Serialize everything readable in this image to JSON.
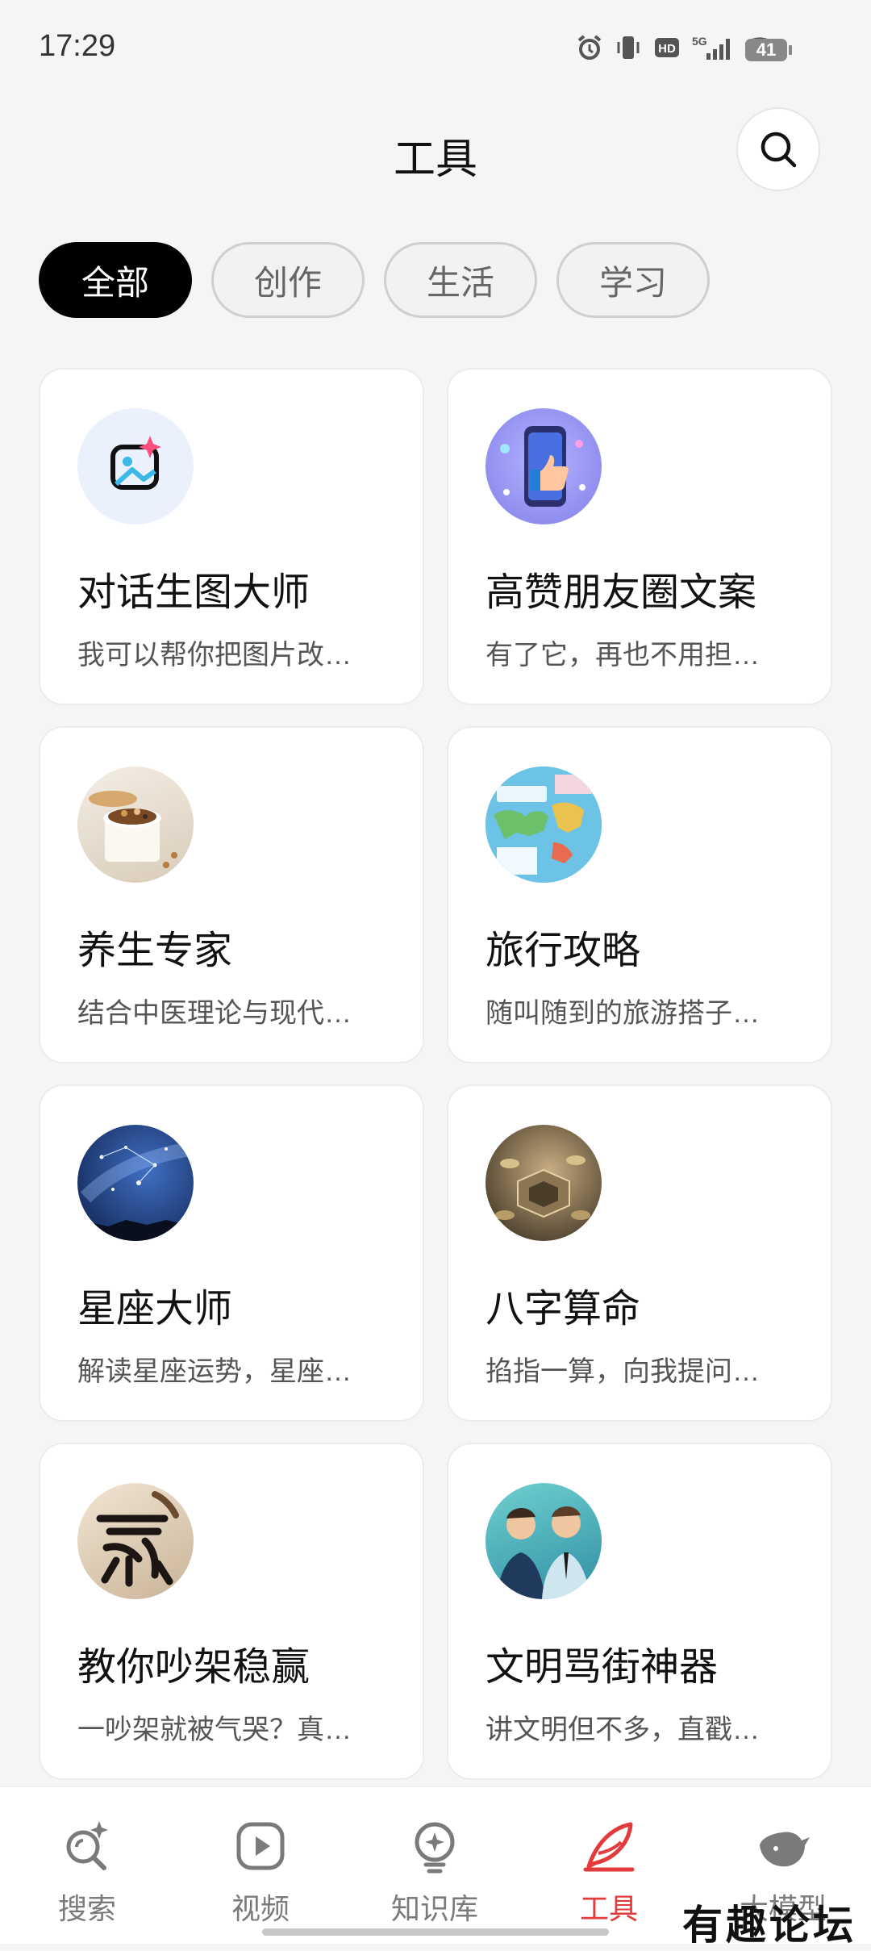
{
  "status": {
    "time": "17:29",
    "battery": "41",
    "network": "5G"
  },
  "header": {
    "title": "工具"
  },
  "chips": [
    {
      "label": "全部",
      "active": true
    },
    {
      "label": "创作",
      "active": false
    },
    {
      "label": "生活",
      "active": false
    },
    {
      "label": "学习",
      "active": false
    }
  ],
  "cards": [
    {
      "title": "对话生图大师",
      "desc": "我可以帮你把图片改…",
      "icon": "image-sparkle-icon"
    },
    {
      "title": "高赞朋友圈文案",
      "desc": "有了它，再也不用担…",
      "icon": "thumbs-up-phone-icon"
    },
    {
      "title": "养生专家",
      "desc": "结合中医理论与现代…",
      "icon": "health-bowl-icon"
    },
    {
      "title": "旅行攻略",
      "desc": "随叫随到的旅游搭子…",
      "icon": "travel-map-icon"
    },
    {
      "title": "星座大师",
      "desc": "解读星座运势，星座…",
      "icon": "starry-sky-icon"
    },
    {
      "title": "八字算命",
      "desc": "掐指一算，向我提问…",
      "icon": "bagua-icon"
    },
    {
      "title": "教你吵架稳赢",
      "desc": "一吵架就被气哭？真…",
      "icon": "calligraphy-icon"
    },
    {
      "title": "文明骂街神器",
      "desc": "讲文明但不多，直戳…",
      "icon": "two-men-icon"
    }
  ],
  "nav": [
    {
      "label": "搜索",
      "icon": "search-sparkle-icon"
    },
    {
      "label": "视频",
      "icon": "play-icon"
    },
    {
      "label": "知识库",
      "icon": "bulb-icon"
    },
    {
      "label": "工具",
      "icon": "feather-icon",
      "active": true
    },
    {
      "label": "大模型",
      "icon": "whale-icon"
    }
  ],
  "watermark": "有趣论坛",
  "accent_color": "#e33b3b"
}
